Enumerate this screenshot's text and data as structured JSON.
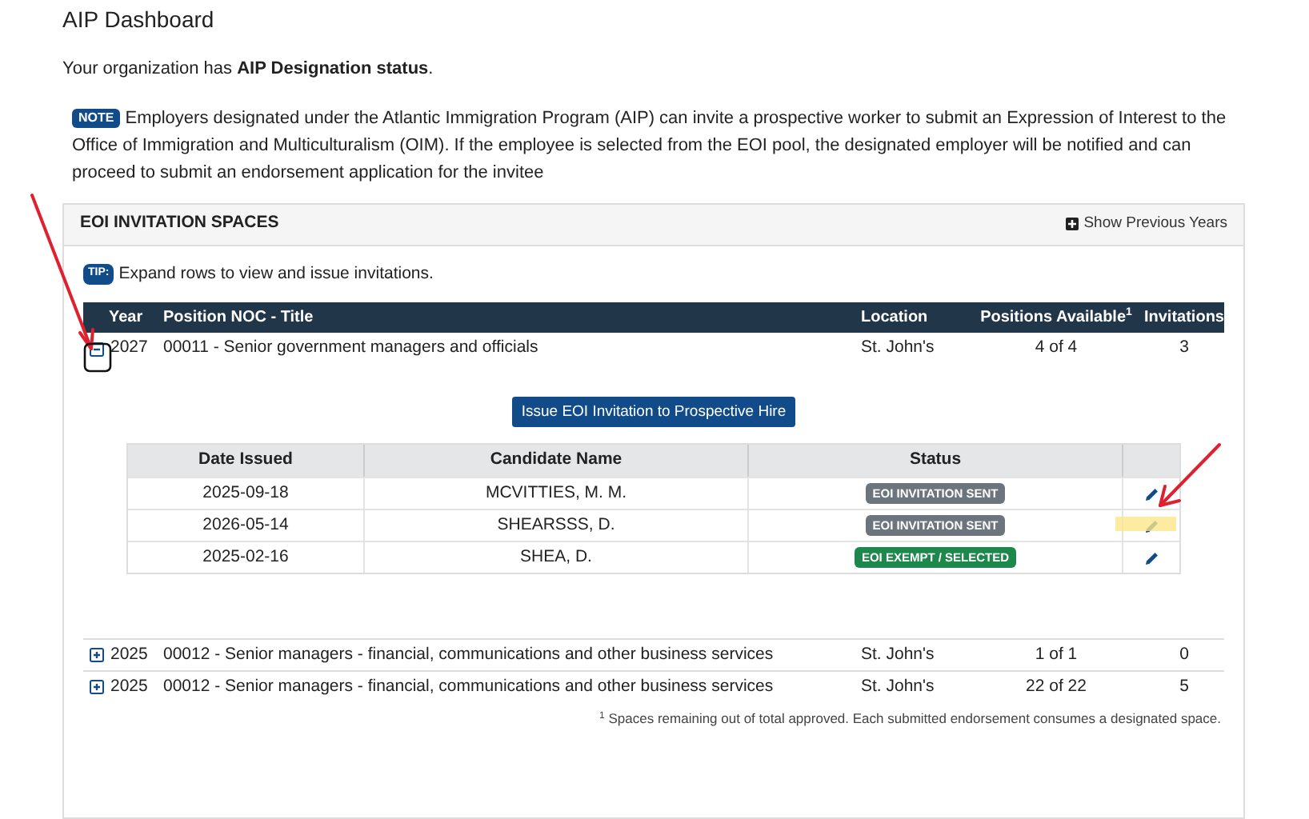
{
  "page_title": "AIP Dashboard",
  "designation": "Your organization has **AIP Designation status**.",
  "note": {
    "badge": "NOTE",
    "text": "Employers designated under the Atlantic Immigration Program (AIP) can invite a prospective worker to submit an Expression of Interest to the Office of Immigration and Multiculturalism (OIM). If the employee is selected from the EOI pool, the designated employer will be notified and can proceed to submit an endorsement application for the invitee"
  },
  "card": {
    "title": "EOI INVITATION SPACES",
    "show_previous": "Show Previous Years",
    "tip": {
      "badge": "TIP:",
      "text": "Expand rows to view and issue invitations."
    },
    "columns": [
      "Year",
      "Position NOC - Title",
      "Location",
      "Positions Available$^{1}$",
      "Invitations"
    ],
    "rows": [
      {
        "year": "2027",
        "position": "00011 - Senior government managers and officials",
        "location": "St. John's",
        "available": "4 of 4",
        "invitations": "3",
        "expanded": true,
        "detail": {
          "button": "Issue EOI Invitation to Prospective Hire",
          "columns": [
            "Date Issued",
            "Candidate Name",
            "Status"
          ],
          "entries": [
            {
              "date": "2025-09-18",
              "name": "MCVITTIES, M. M.",
              "status": "EOI INVITATION SENT",
              "color": "#6c757d"
            },
            {
              "date": "2026-05-14",
              "name": "SHEARSSS, D.",
              "status": "EOI INVITATION SENT",
              "color": "#6c757d"
            },
            {
              "date": "2025-02-16",
              "name": "SHEA, D.",
              "status": "EOI EXEMPT / SELECTED",
              "color": "#1e874b"
            }
          ]
        }
      },
      {
        "year": "2025",
        "position": "00012 - Senior managers - financial, communications and other business services",
        "location": "St. John's",
        "available": "1 of 1",
        "invitations": "0",
        "expanded": false
      },
      {
        "year": "2025",
        "position": "00012 - Senior managers - financial, communications and other business services",
        "location": "St. John's",
        "available": "22 of 22",
        "invitations": "5",
        "expanded": false
      }
    ],
    "footnote": "$^{1}$ Spaces remaining out of total approved. Each submitted endorsement consumes a designated space."
  }
}
